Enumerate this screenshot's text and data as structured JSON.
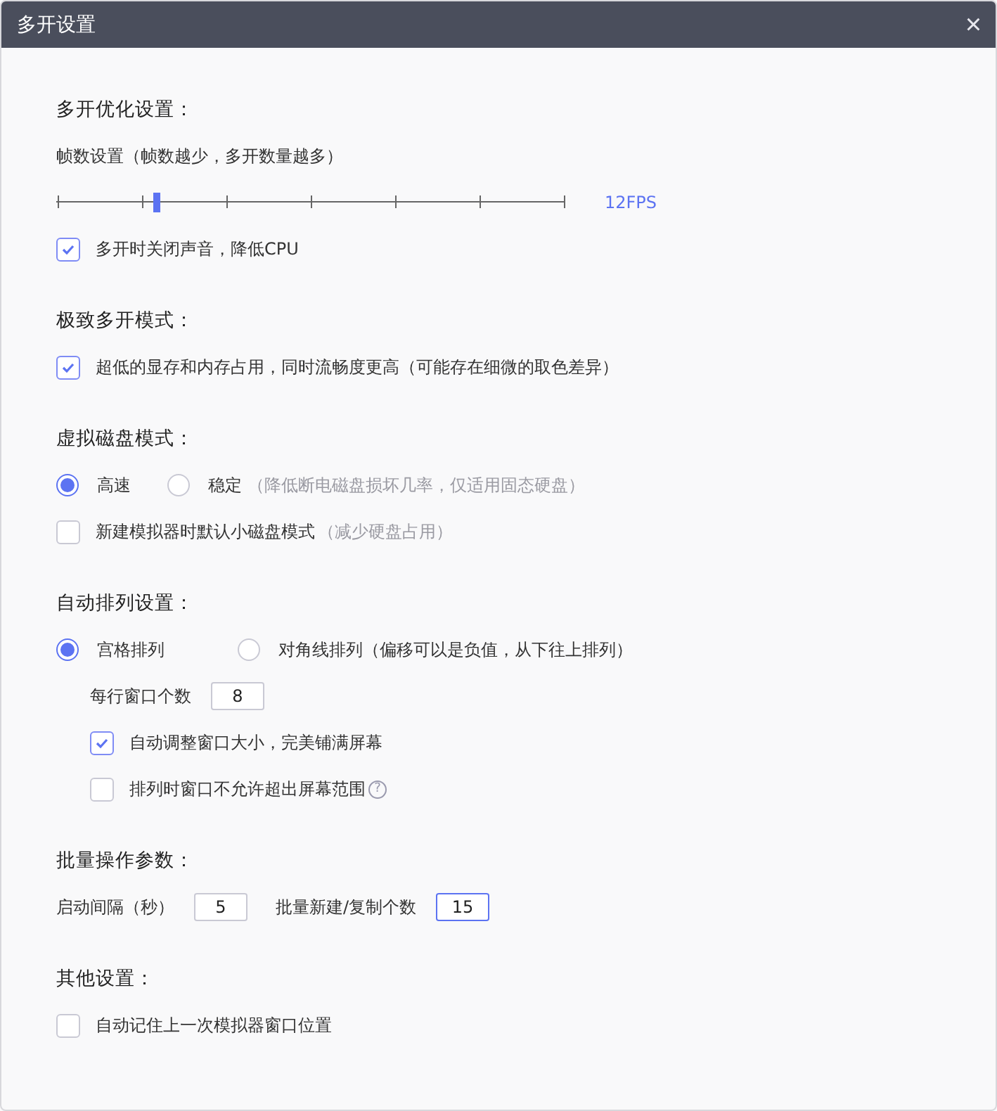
{
  "window": {
    "title": "多开设置",
    "close": "×"
  },
  "sections": [
    {
      "title": "多开优化设置：",
      "items": [
        {
          "kind": "slider",
          "label": "帧数设置（帧数越少，多开数量越多）",
          "level": 0.194,
          "reading": "12FPS"
        },
        {
          "kind": "checkbox",
          "label": "多开时关闭声音，降低CPU",
          "checked": true
        }
      ]
    },
    {
      "title": "极致多开模式：",
      "items": [
        {
          "kind": "checkbox",
          "label": "超低的显存和内存占用，同时流畅度更高（可能存在细微的取色差异）",
          "checked": true
        }
      ]
    },
    {
      "title": "虚拟磁盘模式：",
      "items": [
        {
          "kind": "radio",
          "options": [
            {
              "label": "高速",
              "selected": true
            },
            {
              "label": "稳定",
              "note": "（降低断电磁盘损坏几率，仅适用固态硬盘）",
              "selected": false
            }
          ]
        },
        {
          "kind": "checkbox",
          "label": "新建模拟器时默认小磁盘模式",
          "note": "（减少硬盘占用）",
          "checked": false
        }
      ]
    },
    {
      "title": "自动排列设置：",
      "items": [
        {
          "kind": "radio",
          "options": [
            {
              "label": "宫格排列",
              "selected": true
            },
            {
              "label": "对角线排列（偏移可以是负值，从下往上排列）",
              "selected": false
            }
          ],
          "children": [
            {
              "kind": "fields",
              "fields": [
                {
                  "label": "每行窗口个数",
                  "value": "8",
                  "focused": false
                }
              ]
            },
            {
              "kind": "checkbox",
              "label": "自动调整窗口大小，完美铺满屏幕",
              "checked": true
            },
            {
              "kind": "checkbox",
              "label": "排列时窗口不允许超出屏幕范围",
              "checked": false,
              "help": "?"
            }
          ]
        }
      ]
    },
    {
      "title": "批量操作参数：",
      "items": [
        {
          "kind": "fields",
          "fields": [
            {
              "label": "启动间隔（秒）",
              "value": "5",
              "focused": false
            },
            {
              "label": "批量新建/复制个数",
              "value": "15",
              "focused": true
            }
          ]
        }
      ]
    },
    {
      "title": "其他设置：",
      "items": [
        {
          "kind": "checkbox",
          "label": "自动记住上一次模拟器窗口位置",
          "checked": false
        }
      ]
    }
  ]
}
